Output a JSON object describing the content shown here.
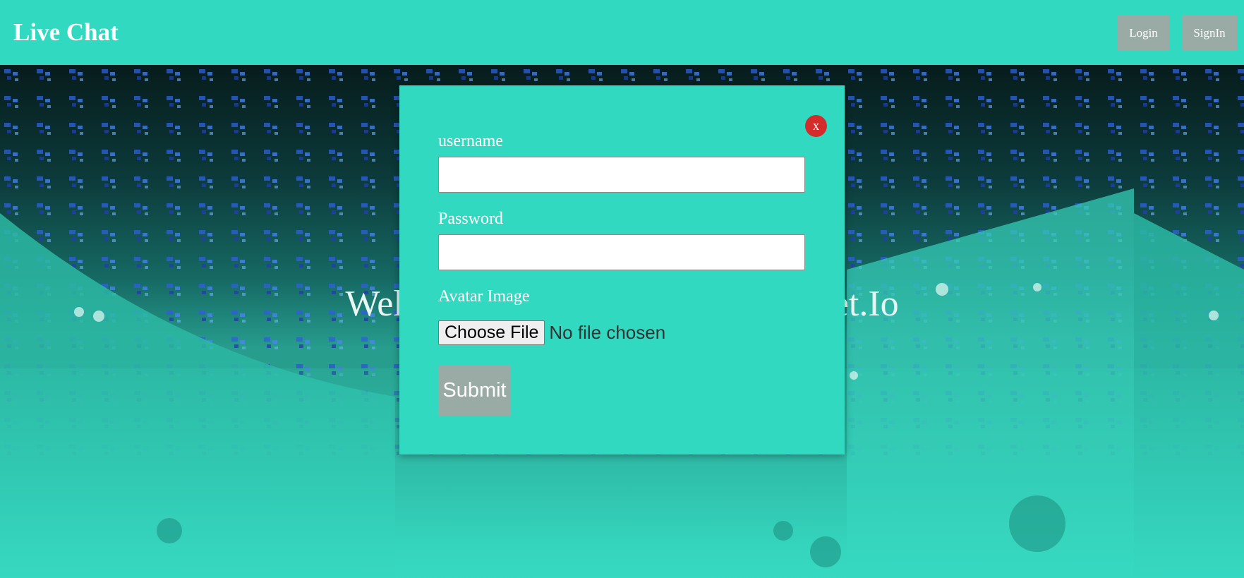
{
  "navbar": {
    "brand": "Live Chat",
    "login_label": "Login",
    "signin_label": "SignIn"
  },
  "hero": {
    "title": "Welcome to Live Chat with Socket.Io"
  },
  "modal": {
    "close_label": "x",
    "username_label": "username",
    "username_value": "",
    "password_label": "Password",
    "password_value": "",
    "avatar_label": "Avatar Image",
    "file_button_label": "Choose File",
    "file_status": "No file chosen",
    "submit_label": "Submit"
  },
  "colors": {
    "primary": "#31d9c0",
    "button_gray": "#9aaba6",
    "close_red": "#d42b2b",
    "text_white": "#ffffff"
  }
}
